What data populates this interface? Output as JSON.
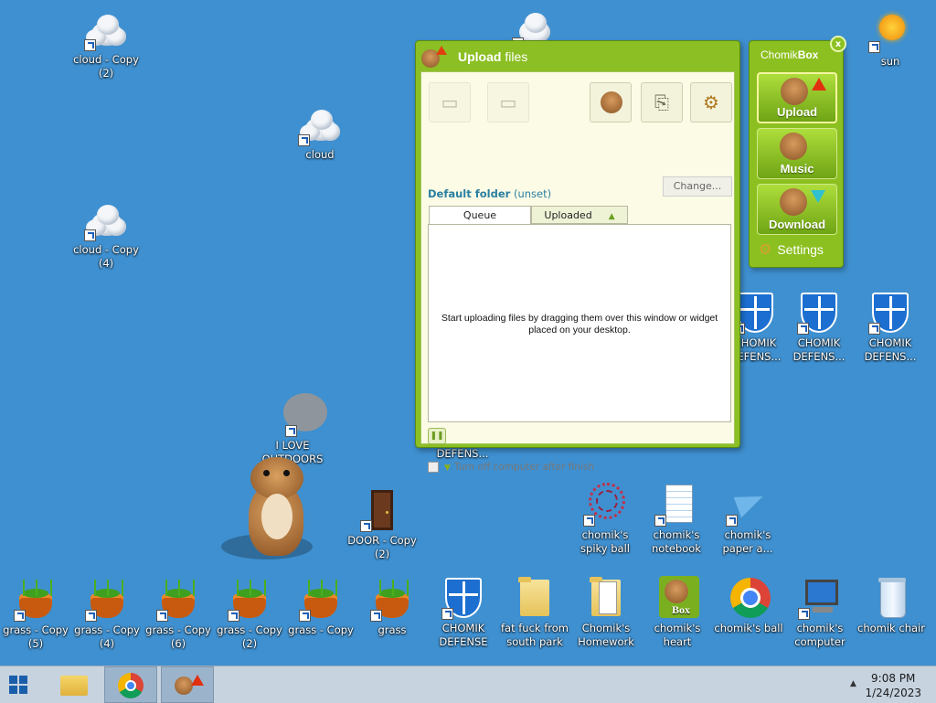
{
  "desktop": {
    "icons": {
      "cloud_copy_2": "cloud - Copy\n(2)",
      "cloud": "cloud",
      "cloud_copy_4": "cloud - Copy\n(4)",
      "sun": "sun",
      "i_love_outdoors": "I LOVE OUTDOORS",
      "door_copy_2": "DOOR - Copy\n(2)",
      "defens_under": "DEFENS...",
      "chomik_defens_1": "CHOMIK DEFENS...",
      "chomik_defens_2": "CHOMIK DEFENS...",
      "chomik_defens_3": "CHOMIK DEFENS...",
      "spiky_ball": "chomik's spiky ball",
      "notebook": "chomik's notebook",
      "paper_a": "chomik's paper a...",
      "grass_copy_5": "grass - Copy\n(5)",
      "grass_copy_4": "grass - Copy\n(4)",
      "grass_copy_6": "grass - Copy\n(6)",
      "grass_copy_2": "grass - Copy\n(2)",
      "grass_copy": "grass - Copy",
      "grass": "grass",
      "chomik_defense": "CHOMIK DEFENSE",
      "fat_folder": "fat fuck from south park",
      "homework": "Chomik's Homework",
      "heart": "chomik's heart",
      "ball": "chomik's ball",
      "computer": "chomik's computer",
      "chair": "chomik chair"
    }
  },
  "upload_window": {
    "title_bold": "Upload",
    "title_rest": " files",
    "default_folder_label": "Default folder",
    "default_folder_value": "(unset)",
    "change_button": "Change...",
    "tabs": [
      "Queue",
      "Uploaded"
    ],
    "queue_message": "Start uploading files by dragging them over this window or widget placed on your desktop.",
    "turn_off_label": "Turn off computer after finish"
  },
  "chomikbox_widget": {
    "title_plain": "Chomik",
    "title_bold": "Box",
    "close": "x",
    "buttons": [
      "Upload",
      "Music",
      "Download"
    ],
    "settings": "Settings"
  },
  "taskbar": {
    "time": "9:08 PM",
    "date": "1/24/2023"
  },
  "colors": {
    "desktop": "#3f90d0",
    "accent_green": "#8bbf24",
    "panel": "#fbfbe6"
  }
}
